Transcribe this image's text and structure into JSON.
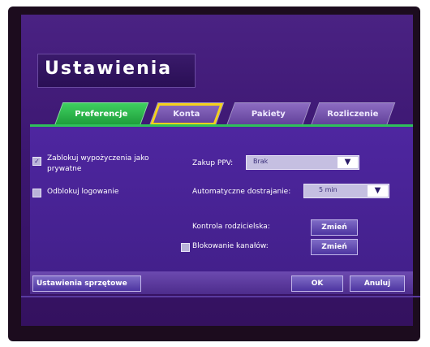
{
  "window": {
    "title": "Ustawienia"
  },
  "tabs": [
    {
      "label": "Preferencje",
      "active": true
    },
    {
      "label": "Konta",
      "focused": true
    },
    {
      "label": "Pakiety"
    },
    {
      "label": "Rozliczenie"
    }
  ],
  "left_options": {
    "lock_rentals": {
      "label_line1": "Zablokuj wypożyczenia jako",
      "label_line2": "prywatne",
      "checked": true
    },
    "unlock_login": {
      "label": "Odblokuj logowanie",
      "checked": false
    }
  },
  "right_options": {
    "ppv": {
      "label": "Zakup PPV:",
      "value": "Brak"
    },
    "auto_tune": {
      "label": "Automatyczne dostrajanie:",
      "value": "5 min"
    },
    "parental": {
      "label": "Kontrola rodzicielska:",
      "button": "Zmień"
    },
    "channel_block": {
      "label": "Blokowanie kanałów:",
      "button": "Zmień",
      "checked": false
    }
  },
  "footer": {
    "hardware_settings": "Ustawienia sprzętowe",
    "ok": "OK",
    "cancel": "Anuluj"
  },
  "colors": {
    "accent_green": "#2fc05b",
    "focus_yellow": "#f5d21b",
    "panel_purple": "#4e26a0"
  }
}
